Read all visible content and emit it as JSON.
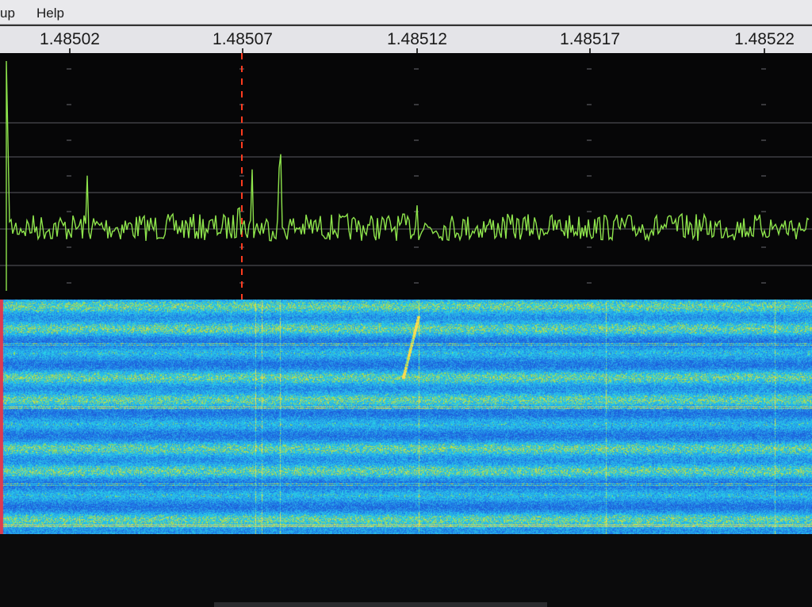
{
  "menu": {
    "items": [
      {
        "id": "setup",
        "label": "up"
      },
      {
        "id": "help",
        "label": "Help"
      }
    ]
  },
  "frequency_axis": {
    "labels": [
      "1.48502",
      "1.48507",
      "1.48512",
      "1.48517",
      "1.48522"
    ]
  },
  "colors": {
    "spectrum_trace": "#8ee44c",
    "marker": "#ff3b1f",
    "waterfall_low": "#1f5ad6",
    "waterfall_mid": "#28b6e6",
    "waterfall_high": "#d6e24a"
  },
  "icons": {
    "frequency_marker": "tuning-marker-icon"
  }
}
